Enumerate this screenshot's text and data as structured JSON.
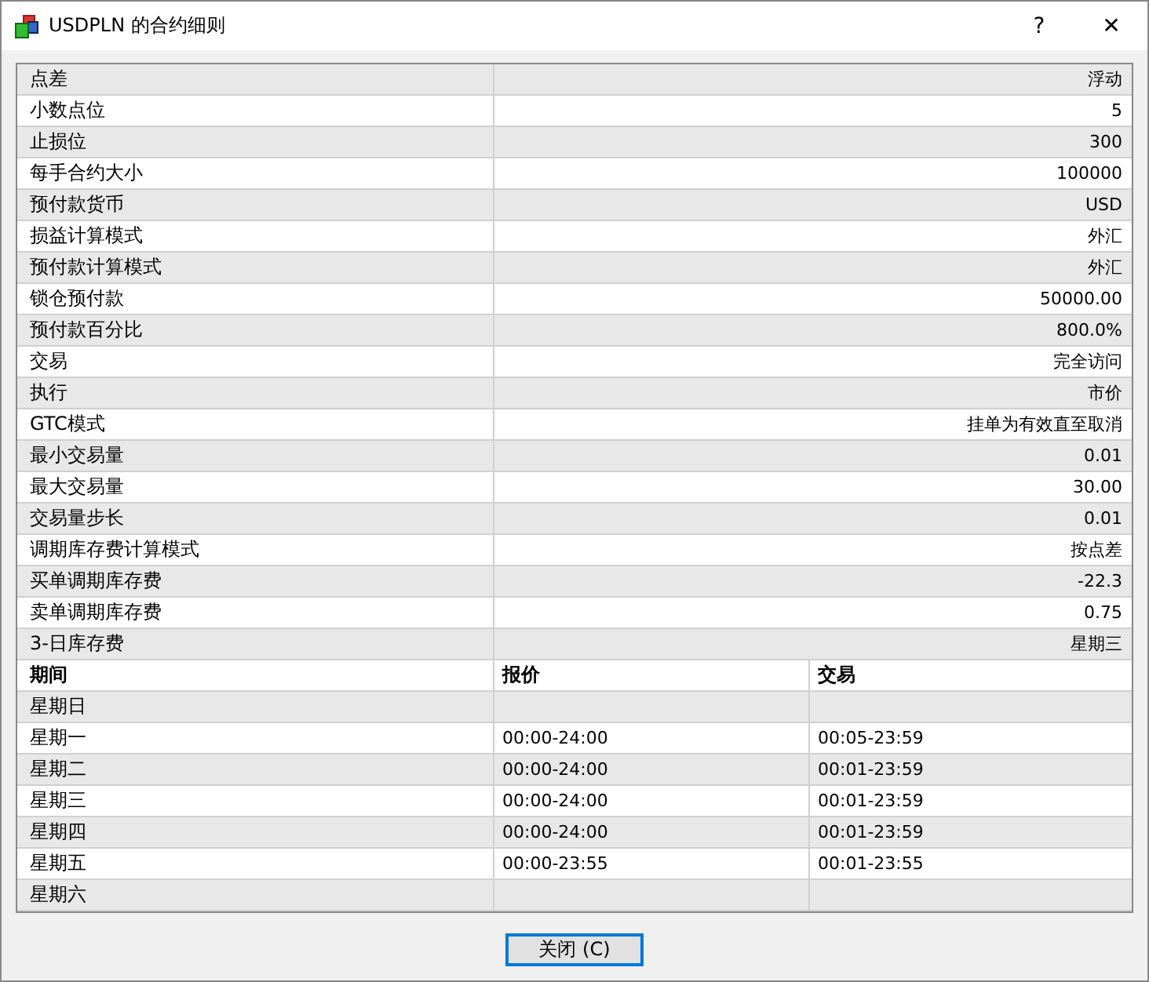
{
  "window": {
    "title": "USDPLN 的合约细则",
    "help": "?",
    "close": "✕"
  },
  "specs": [
    {
      "label": "点差",
      "value": "浮动"
    },
    {
      "label": "小数点位",
      "value": "5"
    },
    {
      "label": "止损位",
      "value": "300"
    },
    {
      "label": "每手合约大小",
      "value": "100000"
    },
    {
      "label": "预付款货币",
      "value": "USD"
    },
    {
      "label": "损益计算模式",
      "value": "外汇"
    },
    {
      "label": "预付款计算模式",
      "value": "外汇"
    },
    {
      "label": "锁仓预付款",
      "value": "50000.00"
    },
    {
      "label": "预付款百分比",
      "value": "800.0%"
    },
    {
      "label": "交易",
      "value": "完全访问"
    },
    {
      "label": "执行",
      "value": "市价"
    },
    {
      "label": "GTC模式",
      "value": "挂单为有效直至取消"
    },
    {
      "label": "最小交易量",
      "value": "0.01"
    },
    {
      "label": "最大交易量",
      "value": "30.00"
    },
    {
      "label": "交易量步长",
      "value": "0.01"
    },
    {
      "label": "调期库存费计算模式",
      "value": "按点差"
    },
    {
      "label": "买单调期库存费",
      "value": "-22.3"
    },
    {
      "label": "卖单调期库存费",
      "value": "0.75"
    },
    {
      "label": "3-日库存费",
      "value": "星期三"
    }
  ],
  "schedule": {
    "columns": [
      "期间",
      "报价",
      "交易"
    ],
    "rows": [
      {
        "day": "星期日"
      },
      {
        "day": "星期一",
        "quotes": "00:00-24:00",
        "trade": "00:05-23:59"
      },
      {
        "day": "星期二",
        "quotes": "00:00-24:00",
        "trade": "00:01-23:59"
      },
      {
        "day": "星期三",
        "quotes": "00:00-24:00",
        "trade": "00:01-23:59"
      },
      {
        "day": "星期四",
        "quotes": "00:00-24:00",
        "trade": "00:01-23:59"
      },
      {
        "day": "星期五",
        "quotes": "00:00-23:55",
        "trade": "00:01-23:55"
      },
      {
        "day": "星期六"
      }
    ]
  },
  "buttons": [
    {
      "label": "关闭 (C)"
    }
  ]
}
